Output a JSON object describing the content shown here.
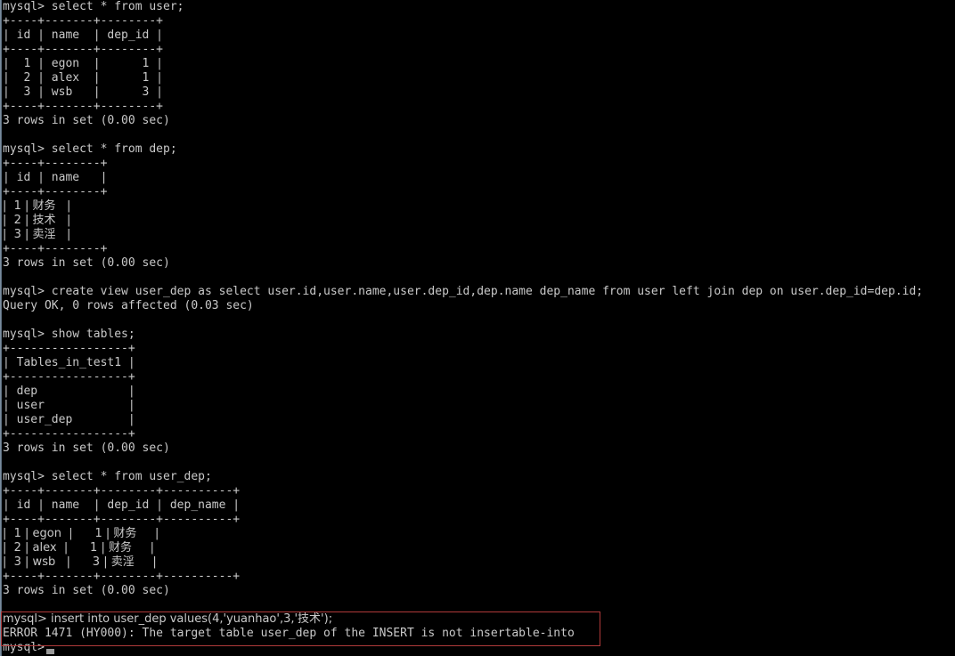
{
  "terminal": {
    "title": "mysql-command-line-client",
    "prompt": "mysql> ",
    "colors": {
      "background": "#000000",
      "foreground": "#c9c9c9",
      "highlight_box_border": "#b03a3a",
      "window_edge": "#7e94a8",
      "cursor": "#9a9a9a"
    },
    "lines": [
      "mysql> select * from user;",
      "+----+-------+--------+",
      "| id | name  | dep_id |",
      "+----+-------+--------+",
      "|  1 | egon  |      1 |",
      "|  2 | alex  |      1 |",
      "|  3 | wsb   |      3 |",
      "+----+-------+--------+",
      "3 rows in set (0.00 sec)",
      "",
      "mysql> select * from dep;",
      "+----+--------+",
      "| id | name   |",
      "+----+--------+",
      "|  1 | 财务   |",
      "|  2 | 技术   |",
      "|  3 | 卖淫   |",
      "+----+--------+",
      "3 rows in set (0.00 sec)",
      "",
      "mysql> create view user_dep as select user.id,user.name,user.dep_id,dep.name dep_name from user left join dep on user.dep_id=dep.id;",
      "Query OK, 0 rows affected (0.03 sec)",
      "",
      "mysql> show tables;",
      "+-----------------+",
      "| Tables_in_test1 |",
      "+-----------------+",
      "| dep             |",
      "| user            |",
      "| user_dep        |",
      "+-----------------+",
      "3 rows in set (0.00 sec)",
      "",
      "mysql> select * from user_dep;",
      "+----+-------+--------+----------+",
      "| id | name  | dep_id | dep_name |",
      "+----+-------+--------+----------+",
      "|  1 | egon  |      1 | 财务     |",
      "|  2 | alex  |      1 | 财务     |",
      "|  3 | wsb   |      3 | 卖淫     |",
      "+----+-------+--------+----------+",
      "3 rows in set (0.00 sec)",
      "",
      "mysql> insert into user_dep values(4,'yuanhao',3,'技术');",
      "ERROR 1471 (HY000): The target table user_dep of the INSERT is not insertable-into",
      "mysql>"
    ],
    "queries": [
      {
        "command": "select * from user;",
        "table": {
          "headers": [
            "id",
            "name",
            "dep_id"
          ],
          "rows": [
            [
              "1",
              "egon",
              "1"
            ],
            [
              "2",
              "alex",
              "1"
            ],
            [
              "3",
              "wsb",
              "3"
            ]
          ]
        },
        "status": "3 rows in set (0.00 sec)"
      },
      {
        "command": "select * from dep;",
        "table": {
          "headers": [
            "id",
            "name"
          ],
          "rows": [
            [
              "1",
              "财务"
            ],
            [
              "2",
              "技术"
            ],
            [
              "3",
              "卖淫"
            ]
          ]
        },
        "status": "3 rows in set (0.00 sec)"
      },
      {
        "command": "create view user_dep as select user.id,user.name,user.dep_id,dep.name dep_name from user left join dep on user.dep_id=dep.id;",
        "status": "Query OK, 0 rows affected (0.03 sec)"
      },
      {
        "command": "show tables;",
        "table": {
          "headers": [
            "Tables_in_test1"
          ],
          "rows": [
            [
              "dep"
            ],
            [
              "user"
            ],
            [
              "user_dep"
            ]
          ]
        },
        "status": "3 rows in set (0.00 sec)"
      },
      {
        "command": "select * from user_dep;",
        "table": {
          "headers": [
            "id",
            "name",
            "dep_id",
            "dep_name"
          ],
          "rows": [
            [
              "1",
              "egon",
              "1",
              "财务"
            ],
            [
              "2",
              "alex",
              "1",
              "财务"
            ],
            [
              "3",
              "wsb",
              "3",
              "卖淫"
            ]
          ]
        },
        "status": "3 rows in set (0.00 sec)"
      },
      {
        "command": "insert into user_dep values(4,'yuanhao',3,'技术');",
        "error": "ERROR 1471 (HY000): The target table user_dep of the INSERT is not insertable-into"
      }
    ],
    "highlight": {
      "note": "red rectangle around failed insert and its error message",
      "line_indices": [
        43,
        44
      ]
    },
    "cursor": {
      "visible": true,
      "line_index": 45
    }
  }
}
